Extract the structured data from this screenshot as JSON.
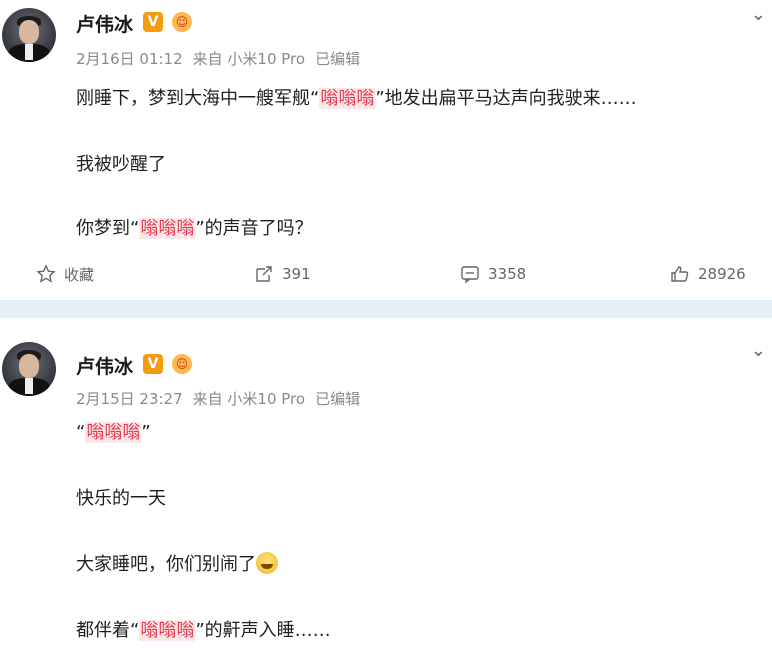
{
  "post1": {
    "author": "卢伟冰",
    "vip_badge": "V",
    "meta": {
      "date": "2月16日 01:12",
      "source": "来自 小米10 Pro",
      "edited": "已编辑"
    },
    "lines": [
      {
        "before": "刚睡下，梦到大海中一艘军舰“",
        "highlight": "嗡嗡嗡",
        "after": "”地发出扁平马达声向我驶来……"
      },
      {
        "before": "我被吵醒了",
        "highlight": "",
        "after": ""
      },
      {
        "before": "你梦到“",
        "highlight": "嗡嗡嗡",
        "after": "”的声音了吗？"
      }
    ],
    "actions": {
      "favorite_label": "收藏",
      "repost_count": "391",
      "comment_count": "3358",
      "like_count": "28926"
    }
  },
  "post2": {
    "author": "卢伟冰",
    "vip_badge": "V",
    "meta": {
      "date": "2月15日 23:27",
      "source": "来自 小米10 Pro",
      "edited": "已编辑"
    },
    "lines": [
      {
        "before": "“",
        "highlight": "嗡嗡嗡",
        "after": "”"
      },
      {
        "before": "快乐的一天",
        "highlight": "",
        "after": ""
      },
      {
        "before": "大家睡吧，你们别闹了",
        "highlight": "",
        "after": ""
      },
      {
        "before": "都伴着“",
        "highlight": "嗡嗡嗡",
        "after": "”的鼾声入睡……"
      }
    ]
  },
  "colors": {
    "highlight": "#e0384b",
    "divider": "#e3eef7",
    "vip": "#f39c12"
  }
}
